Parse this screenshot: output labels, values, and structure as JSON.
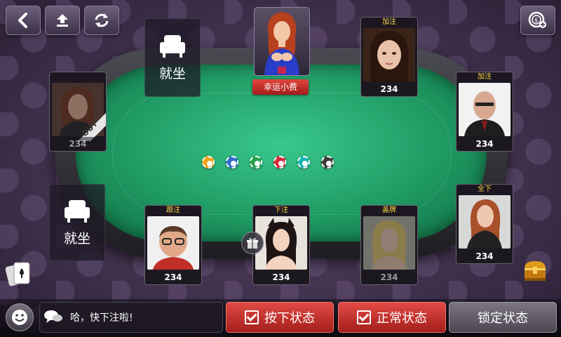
{
  "table": {
    "tip_button": "幸运小费",
    "pot_chips": [
      {
        "color": "#f2a418"
      },
      {
        "color": "#2d6cc8"
      },
      {
        "color": "#23a14a"
      },
      {
        "color": "#d8283a"
      },
      {
        "color": "#18b2b2"
      },
      {
        "color": "#3a3a3a"
      }
    ]
  },
  "seats": {
    "empty_top_left": {
      "label": "就坐"
    },
    "empty_left": {
      "label": "就坐"
    },
    "player_left_top": {
      "chips": "234",
      "badge": "OUT",
      "action": ""
    },
    "player_top_right": {
      "chips": "234",
      "action": "加注"
    },
    "player_right_top": {
      "chips": "234",
      "action": "加注"
    },
    "player_right_bottom": {
      "chips": "234",
      "action": "全下"
    },
    "player_bottom_1": {
      "chips": "234",
      "action": "跟注"
    },
    "player_bottom_2": {
      "chips": "234",
      "action": "下注"
    },
    "player_bottom_3": {
      "chips": "234",
      "action": "盖牌"
    }
  },
  "chat": {
    "message": "哈，快下注啦!"
  },
  "actions": {
    "press_state": "按下状态",
    "normal_state": "正常状态",
    "locked_state": "锁定状态"
  },
  "colors": {
    "felt": "#1f9a63",
    "red_button": "#c2302c",
    "action_tag": "#ffd84a"
  }
}
